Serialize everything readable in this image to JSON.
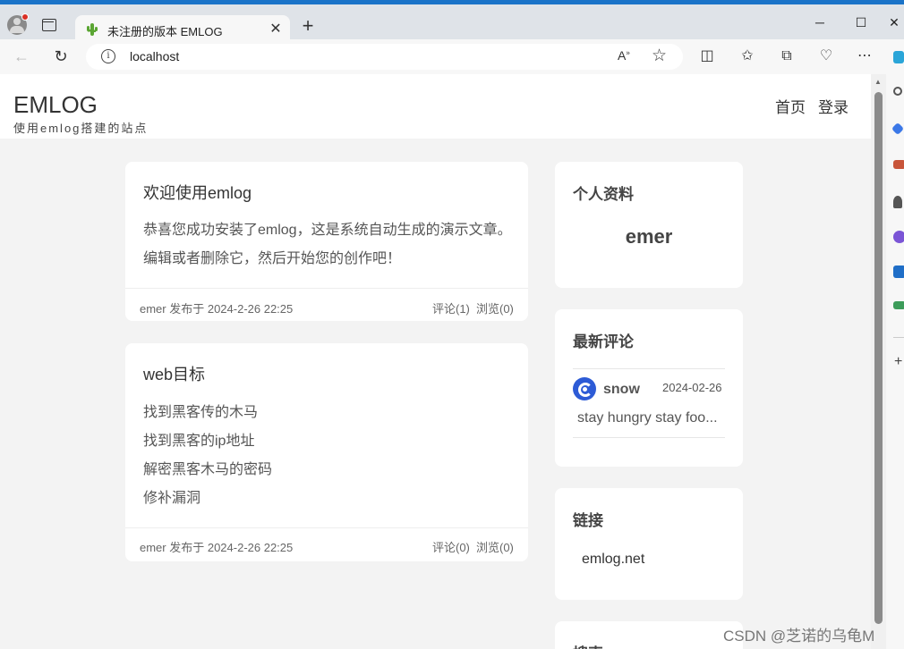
{
  "browser": {
    "tab_title": "未注册的版本 EMLOG",
    "tab_close": "✕",
    "new_tab": "+",
    "url": "localhost",
    "window": {
      "minimize": "─",
      "maximize": "☐",
      "close": "✕"
    }
  },
  "site": {
    "title": "EMLOG",
    "subtitle": "使用emlog搭建的站点",
    "nav": [
      "首页",
      "登录"
    ]
  },
  "posts": [
    {
      "title": "欢迎使用emlog",
      "lines": [
        "恭喜您成功安装了emlog，这是系统自动生成的演示文章。",
        "编辑或者删除它，然后开始您的创作吧！"
      ],
      "meta": "emer 发布于  2024-2-26 22:25",
      "comments": "评论(1)",
      "views": "浏览(0)"
    },
    {
      "title": "web目标",
      "lines": [
        "找到黑客传的木马",
        "找到黑客的ip地址",
        "解密黑客木马的密码",
        "修补漏洞"
      ],
      "meta": "emer 发布于  2024-2-26 22:25",
      "comments": "评论(0)",
      "views": "浏览(0)"
    }
  ],
  "sidebar": {
    "profile": {
      "title": "个人资料",
      "name": "emer"
    },
    "comments": {
      "title": "最新评论",
      "item": {
        "author": "snow",
        "date": "2024-02-26",
        "text": "stay hungry stay foo..."
      }
    },
    "links": {
      "title": "链接",
      "items": [
        "emlog.net"
      ]
    },
    "search": {
      "title": "搜索"
    }
  },
  "watermark": "CSDN @芝诺的乌龟M",
  "colors": {
    "accent": "#1a73c8",
    "avatar": "#2d5bd6",
    "page_bg": "#f3f3f3"
  }
}
